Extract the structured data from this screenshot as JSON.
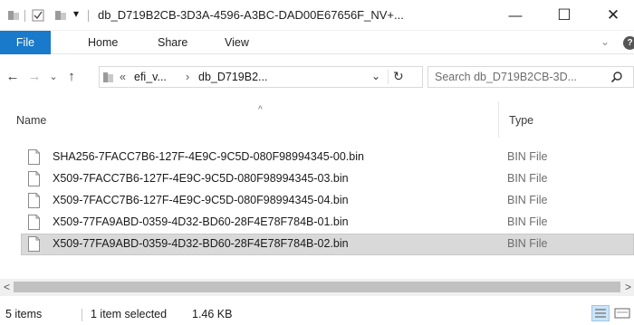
{
  "window": {
    "title": "db_D719B2CB-3D3A-4596-A3BC-DAD00E67656F_NV+...",
    "minimize_glyph": "—",
    "maximize_glyph": "☐",
    "close_glyph": "✕",
    "quick_access_dropdown_glyph": "▾"
  },
  "ribbon": {
    "tabs": [
      {
        "label": "File"
      },
      {
        "label": "Home"
      },
      {
        "label": "Share"
      },
      {
        "label": "View"
      }
    ],
    "expand_glyph": "⌄",
    "help_glyph": "?"
  },
  "nav": {
    "back_glyph": "←",
    "forward_glyph": "→",
    "recent_glyph": "⌄",
    "up_glyph": "↑",
    "overflow": "«",
    "crumbs": [
      "efi_v...",
      "db_D719B2..."
    ],
    "crumb_separator": "›",
    "dropdown_glyph": "⌄",
    "refresh_glyph": "↻"
  },
  "search": {
    "placeholder": "Search db_D719B2CB-3D..."
  },
  "columns": {
    "name": "Name",
    "type": "Type",
    "sort_glyph": "^"
  },
  "files": [
    {
      "name": "SHA256-7FACC7B6-127F-4E9C-9C5D-080F98994345-00.bin",
      "type": "BIN File",
      "selected": false
    },
    {
      "name": "X509-7FACC7B6-127F-4E9C-9C5D-080F98994345-03.bin",
      "type": "BIN File",
      "selected": false
    },
    {
      "name": "X509-7FACC7B6-127F-4E9C-9C5D-080F98994345-04.bin",
      "type": "BIN File",
      "selected": false
    },
    {
      "name": "X509-77FA9ABD-0359-4D32-BD60-28F4E78F784B-01.bin",
      "type": "BIN File",
      "selected": false
    },
    {
      "name": "X509-77FA9ABD-0359-4D32-BD60-28F4E78F784B-02.bin",
      "type": "BIN File",
      "selected": true
    }
  ],
  "scrollbar": {
    "left_glyph": "<",
    "right_glyph": ">"
  },
  "status": {
    "items": "5 items",
    "selection": "1 item selected",
    "size": "1.46 KB"
  },
  "colors": {
    "file_tab": "#1979ca",
    "selected_row": "#d9d9d9",
    "folder_yellow": "#e8c15a"
  }
}
